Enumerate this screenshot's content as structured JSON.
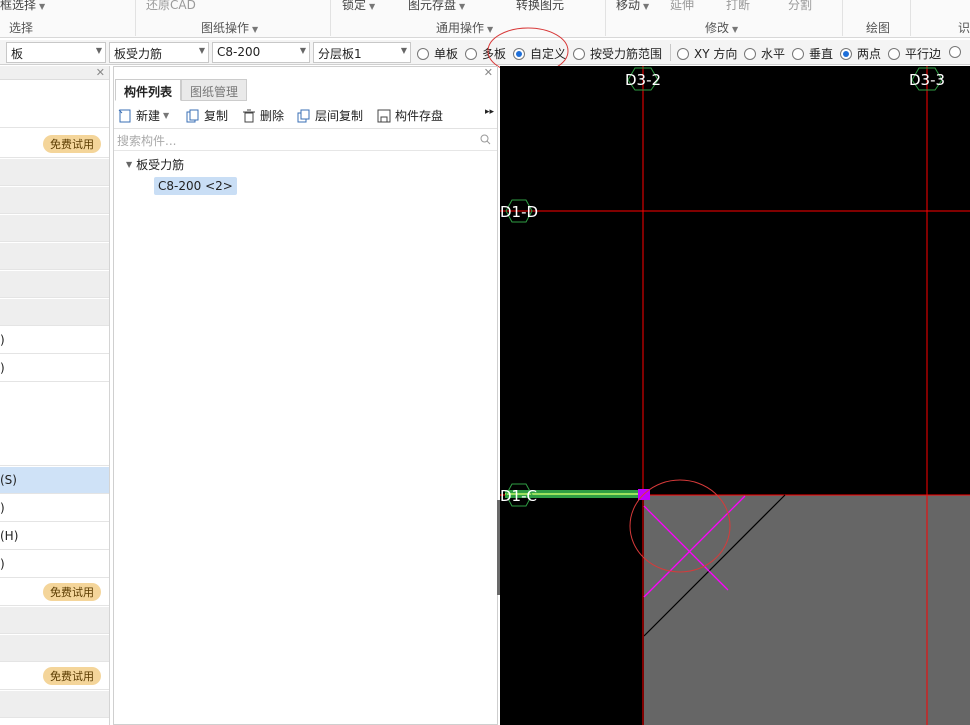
{
  "ribbon": {
    "top_items": [
      "框选择",
      "还原CAD",
      "锁定",
      "图元存盘",
      "转换图元",
      "移动",
      "延伸",
      "打断",
      "分割"
    ],
    "groups": [
      "选择",
      "图纸操作",
      "通用操作",
      "修改",
      "绘图",
      "识"
    ]
  },
  "propbar": {
    "combos": [
      "板",
      "板受力筋",
      "C8-200",
      "分层板1"
    ],
    "radios": [
      {
        "label": "单板",
        "checked": false
      },
      {
        "label": "多板",
        "checked": false
      },
      {
        "label": "自定义",
        "checked": true
      },
      {
        "label": "按受力筋范围",
        "checked": false
      },
      {
        "label": "XY 方向",
        "checked": false
      },
      {
        "label": "水平",
        "checked": false
      },
      {
        "label": "垂直",
        "checked": false
      },
      {
        "label": "两点",
        "checked": true
      },
      {
        "label": "平行边",
        "checked": false
      }
    ]
  },
  "leftpanel": {
    "trial_label": "免费试用",
    "rows": [
      ")",
      ")",
      "(S)",
      ")",
      "(H)",
      ")"
    ]
  },
  "midpanel": {
    "tabs": [
      "构件列表",
      "图纸管理"
    ],
    "toolbar": [
      "新建",
      "复制",
      "删除",
      "层间复制",
      "构件存盘"
    ],
    "search_placeholder": "搜索构件...",
    "tree_parent": "板受力筋",
    "tree_child": "C8-200 <2>"
  },
  "canvas": {
    "axis_labels": [
      "D3-2",
      "D3-3",
      "D1-D",
      "D1-C"
    ],
    "colors": {
      "background": "#000000",
      "axis": "#ff0000",
      "rebar": "#ff00ff",
      "slab": "#666666",
      "marker": "#2f9e44",
      "highlight_circle": "#d83a3a"
    }
  }
}
